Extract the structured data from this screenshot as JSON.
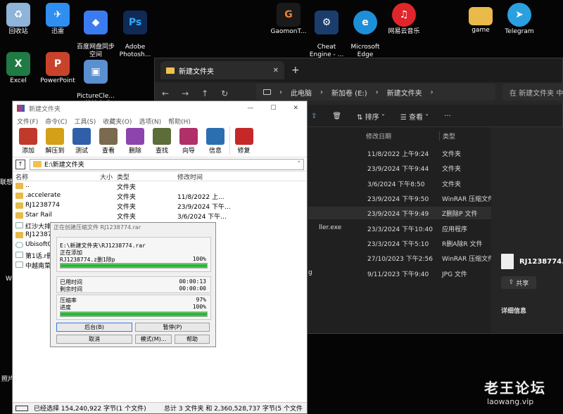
{
  "desktop": {
    "icons": [
      {
        "label": "回收站",
        "color": "#8fb3d9",
        "glyph": "♻"
      },
      {
        "label": "迅雷",
        "color": "#2f8ef0",
        "glyph": "✈"
      },
      {
        "label": "百度网盘同步\n空间",
        "color": "#3b7bf0",
        "glyph": "◆"
      },
      {
        "label": "Adobe\nPhotosh...",
        "color": "#0e2a55",
        "glyph": "Ps"
      },
      {
        "label": "GaomonT...",
        "color": "#1a1a1a",
        "glyph": "G"
      },
      {
        "label": "Cheat\nEngine - ...",
        "color": "#1b3d6e",
        "glyph": "⚙"
      },
      {
        "label": "Microsoft\nEdge",
        "color": "#1d8fd8",
        "glyph": "e"
      },
      {
        "label": "网易云音乐",
        "color": "#e0262b",
        "glyph": "♫"
      },
      {
        "label": "game",
        "color": "#e9b949",
        "glyph": ""
      },
      {
        "label": "Telegram",
        "color": "#2aa0e0",
        "glyph": "➤"
      },
      {
        "label": "Excel",
        "color": "#1f7a44",
        "glyph": "X"
      },
      {
        "label": "PowerPoint",
        "color": "#c9432b",
        "glyph": "P"
      },
      {
        "label": "PictureCle...\n- 快捷方式",
        "color": "#5a8fd0",
        "glyph": "▣"
      }
    ],
    "left_edge_labels": [
      "联想",
      "W",
      "照片"
    ]
  },
  "explorer": {
    "tab_title": "新建文件夹",
    "tab_close": "✕",
    "new_tab": "+",
    "nav": {
      "back": "←",
      "forward": "→",
      "up": "↑",
      "refresh": "↻"
    },
    "breadcrumb": [
      "此电脑",
      "新加卷 (E:)",
      "新建文件夹"
    ],
    "search_placeholder": "在 新建文件夹 中",
    "toolbar": {
      "sort": "排序",
      "view": "查看",
      "more": "···"
    },
    "columns": {
      "modified": "修改日期",
      "type": "类型"
    },
    "rows": [
      {
        "name": "",
        "modified": "11/8/2022 上午9:24",
        "type": "文件夹"
      },
      {
        "name": "",
        "modified": "23/9/2024 下午9:44",
        "type": "文件夹"
      },
      {
        "name": "",
        "modified": "3/6/2024 下午8:50",
        "type": "文件夹"
      },
      {
        "name": "",
        "modified": "23/9/2024 下午9:50",
        "type": "WinRAR 压缩文件"
      },
      {
        "name": "",
        "modified": "23/9/2024 下午9:49",
        "type": "Z删除P 文件"
      },
      {
        "name": "ller.exe",
        "modified": "23/3/2024 下午10:40",
        "type": "应用程序"
      },
      {
        "name": "",
        "modified": "23/3/2024 下午5:10",
        "type": "R删A除R 文件"
      },
      {
        "name": "",
        "modified": "27/10/2023 下午2:56",
        "type": "WinRAR 压缩文件"
      },
      {
        "name": "g",
        "modified": "9/11/2023 下午9:40",
        "type": "JPG 文件"
      }
    ],
    "details": {
      "file_name": "RJ1238774.z",
      "share": "共享",
      "info": "详细信息"
    }
  },
  "winrar": {
    "title": "新建文件夹",
    "window_buttons": {
      "min": "—",
      "max": "☐",
      "close": "✕"
    },
    "menu": [
      "文件(F)",
      "命令(C)",
      "工具(S)",
      "收藏夹(O)",
      "选项(N)",
      "帮助(H)"
    ],
    "tools": [
      {
        "label": "添加",
        "color": "#c0392b"
      },
      {
        "label": "解压到",
        "color": "#d4a017"
      },
      {
        "label": "测试",
        "color": "#2e5fa8"
      },
      {
        "label": "查看",
        "color": "#7a6a4f"
      },
      {
        "label": "删除",
        "color": "#8e44ad"
      },
      {
        "label": "查找",
        "color": "#5d6d3a"
      },
      {
        "label": "向导",
        "color": "#b0306a"
      },
      {
        "label": "信息",
        "color": "#2c6fb0"
      },
      {
        "label": "修复",
        "color": "#c62828"
      }
    ],
    "path": "E:\\新建文件夹",
    "headers": {
      "name": "名称",
      "size": "大小",
      "type": "类型",
      "modified": "修改时间"
    },
    "files": [
      {
        "name": "..",
        "size": "",
        "type": "文件夹",
        "modified": "",
        "kind": "folder"
      },
      {
        "name": ".accelerate",
        "size": "",
        "type": "文件夹",
        "modified": "11/8/2022 上...",
        "kind": "folder"
      },
      {
        "name": "RJ1238774",
        "size": "",
        "type": "文件夹",
        "modified": "23/9/2024 下午...",
        "kind": "folder"
      },
      {
        "name": "Star Rail",
        "size": "",
        "type": "文件夹",
        "modified": "3/6/2024 下午...",
        "kind": "folder"
      },
      {
        "name": "红沙大排档",
        "size": "",
        "type": "",
        "modified": "",
        "kind": "file"
      },
      {
        "name": "RJ12387",
        "size": "",
        "type": "",
        "modified": "",
        "kind": "folder"
      },
      {
        "name": "UbisoftCo",
        "size": "",
        "type": "",
        "modified": "",
        "kind": "file"
      },
      {
        "name": "第1话.r删",
        "size": "",
        "type": "",
        "modified": "",
        "kind": "file"
      },
      {
        "name": "中越南菜店",
        "size": "",
        "type": "",
        "modified": "",
        "kind": "file"
      }
    ],
    "status_left": "已经选择 154,240,922 字节(1 个文件)",
    "status_right": "总计 3 文件夹 和 2,360,528,737 字节(5 个文件"
  },
  "progress_dialog": {
    "title": "正在创建压缩文件 RJ1238774.rar",
    "archive_path": "E:\\新建文件夹\\RJ1238774.rar",
    "adding_label": "正在添加",
    "current_file": "RJ1238774.z删1除p",
    "file_percent": "100%",
    "file_progress": 1.0,
    "elapsed_label": "已用时间",
    "elapsed": "00:00:13",
    "remaining_label": "剩余时间",
    "remaining": "00:00:00",
    "ratio_label": "压缩率",
    "ratio": "97%",
    "progress_label": "进度",
    "progress": "100%",
    "total_progress": 1.0,
    "buttons": {
      "background": "后台(B)",
      "pause": "暂停(P)",
      "cancel": "取消",
      "mode": "模式(M)...",
      "help": "帮助"
    }
  },
  "watermark": {
    "title": "老王论坛",
    "url": "laowang.vip"
  }
}
